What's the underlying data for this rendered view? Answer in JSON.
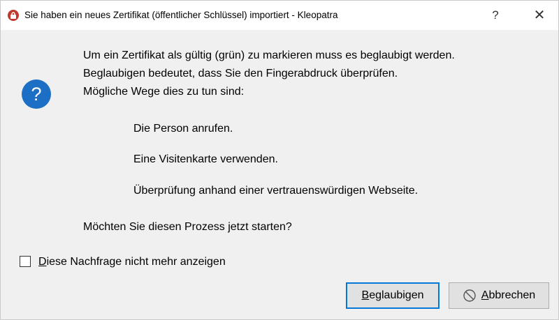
{
  "window": {
    "title": "Sie haben ein neues Zertifikat (öffentlicher Schlüssel) importiert - Kleopatra",
    "help_symbol": "?",
    "close_symbol": "✕",
    "app_icon": "kleopatra-icon"
  },
  "message": {
    "icon": "question-icon",
    "icon_glyph": "?",
    "lines": [
      "Um ein Zertifikat als gültig (grün) zu markieren muss es beglaubigt werden.",
      "Beglaubigen bedeutet, dass Sie den Fingerabdruck überprüfen.",
      "Mögliche Wege dies zu tun sind:"
    ],
    "ways": [
      "Die Person anrufen.",
      "Eine Visitenkarte verwenden.",
      "Überprüfung anhand einer vertrauenswürdigen Webseite."
    ],
    "prompt": "Möchten Sie diesen Prozess jetzt starten?"
  },
  "checkbox": {
    "mnemonic": "D",
    "label_rest": "iese Nachfrage nicht mehr anzeigen",
    "checked": false
  },
  "buttons": {
    "certify": {
      "mnemonic": "B",
      "label_rest": "eglaubigen"
    },
    "cancel": {
      "mnemonic": "A",
      "label_rest": "bbrechen",
      "icon": "cancel-icon"
    }
  },
  "colors": {
    "accent": "#0078d7",
    "question_icon": "#1c6fc4",
    "app_icon": "#c0392b"
  }
}
